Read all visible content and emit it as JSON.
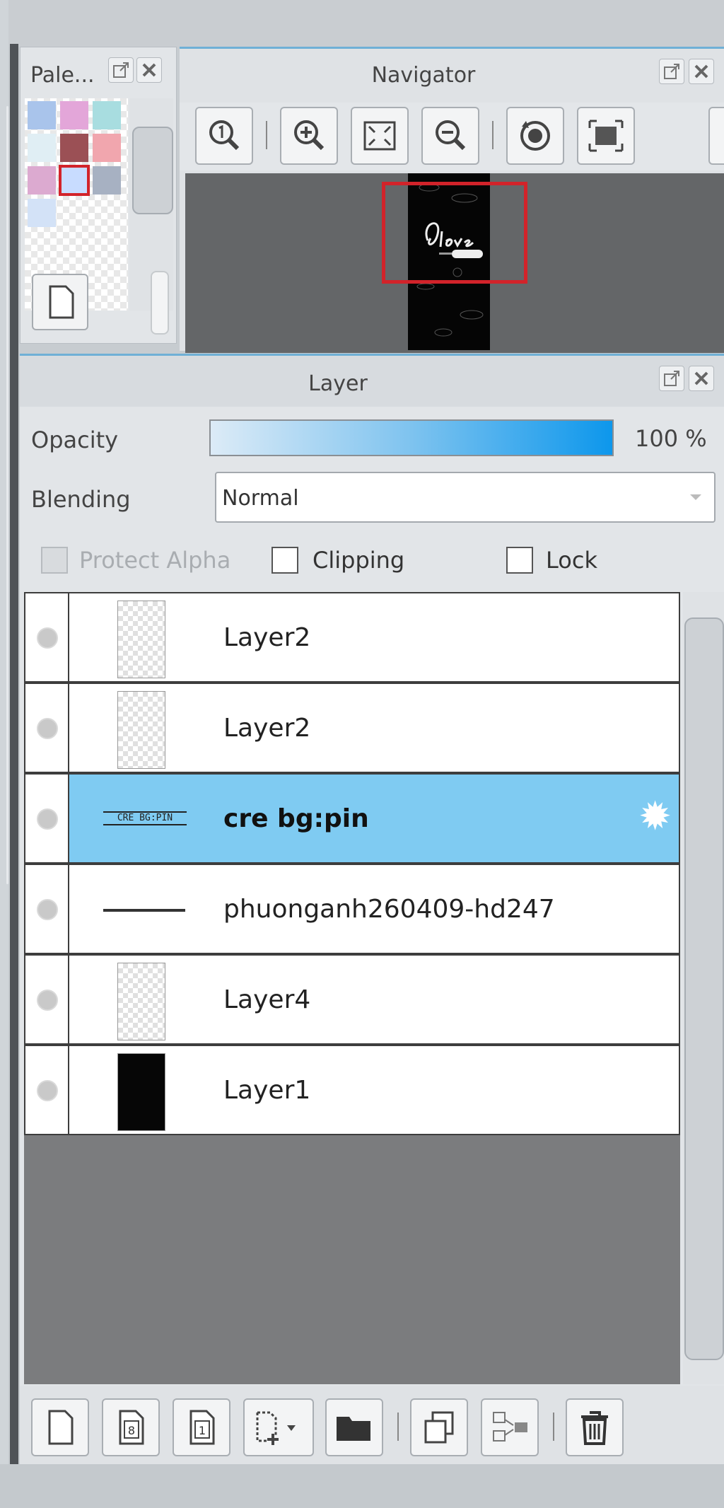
{
  "palette": {
    "title": "Pale...",
    "swatches": [
      "#a9c4eb",
      "#e3a6d9",
      "#a8dde0",
      "#e0eef4",
      "#9b5055",
      "#f1a6ae",
      "#dcaad0",
      "#c8dcff",
      "#a7b1c2",
      "#d3e2f7"
    ],
    "selected_index": 7
  },
  "navigator": {
    "title": "Navigator",
    "tools": [
      "zoom-actual-icon",
      "zoom-in-icon",
      "fit-view-icon",
      "zoom-out-icon",
      "rotate-icon",
      "fullscreen-icon"
    ]
  },
  "layer_panel": {
    "title": "Layer",
    "opacity_label": "Opacity",
    "opacity_value": "100 %",
    "opacity_percent": 100,
    "blending_label": "Blending",
    "blending_value": "Normal",
    "protect_alpha_label": "Protect Alpha",
    "clipping_label": "Clipping",
    "lock_label": "Lock",
    "layers": [
      {
        "name": "Layer2",
        "thumb": "transparent",
        "selected": false
      },
      {
        "name": "Layer2",
        "thumb": "transparent",
        "selected": false
      },
      {
        "name": "cre bg:pin",
        "thumb": "text",
        "thumb_text": "CRE BG:PIN",
        "selected": true
      },
      {
        "name": "phuonganh260409-hd247",
        "thumb": "line",
        "selected": false
      },
      {
        "name": "Layer4",
        "thumb": "transparent",
        "selected": false
      },
      {
        "name": "Layer1",
        "thumb": "dark",
        "selected": false
      }
    ],
    "footer_tools": [
      "new-layer-icon",
      "new-8bit-layer-icon",
      "new-1bit-layer-icon",
      "add-layer-menu-icon",
      "new-folder-icon",
      "duplicate-layer-icon",
      "merge-layer-icon",
      "delete-layer-icon"
    ]
  },
  "colors": {
    "accent": "#6fb0d6",
    "selected_row": "#7fcbf2",
    "navigator_frame": "#d2232a"
  }
}
